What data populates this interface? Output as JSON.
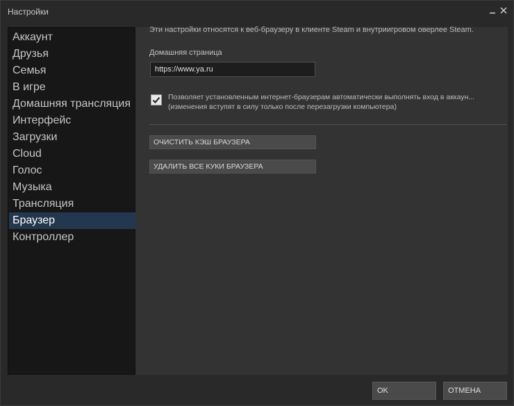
{
  "window": {
    "title": "Настройки",
    "minimize_icon": "minimize-icon",
    "close_icon": "close-icon"
  },
  "sidebar": {
    "items": [
      {
        "label": "Аккаунт"
      },
      {
        "label": "Друзья"
      },
      {
        "label": "Семья"
      },
      {
        "label": "В игре"
      },
      {
        "label": "Домашняя трансляция"
      },
      {
        "label": "Интерфейс"
      },
      {
        "label": "Загрузки"
      },
      {
        "label": "Cloud"
      },
      {
        "label": "Голос"
      },
      {
        "label": "Музыка"
      },
      {
        "label": "Трансляция"
      },
      {
        "label": "Браузер"
      },
      {
        "label": "Контроллер"
      }
    ],
    "active_index": 11
  },
  "browser": {
    "description": "Эти настройки относятся к веб-браузеру в клиенте Steam и внутриигровом оверлее Steam.",
    "homepage_label": "Домашняя страница",
    "homepage_value": "https://www.ya.ru",
    "autologin_checked": true,
    "autologin_line1": "Позволяет установленным интернет-браузерам автоматически выполнять вход в аккаун...",
    "autologin_line2": "(изменения вступят в силу только после перезагрузки компьютера)",
    "clear_cache_label": "ОЧИСТИТЬ КЭШ БРАУЗЕРА",
    "delete_cookies_label": "УДАЛИТЬ ВСЕ КУКИ БРАУЗЕРА"
  },
  "footer": {
    "ok_label": "OK",
    "cancel_label": "ОТМЕНА"
  },
  "colors": {
    "active_item_bg": "#23374f",
    "window_bg": "#292929",
    "panel_bg": "#333333",
    "sidebar_bg": "#171717"
  }
}
